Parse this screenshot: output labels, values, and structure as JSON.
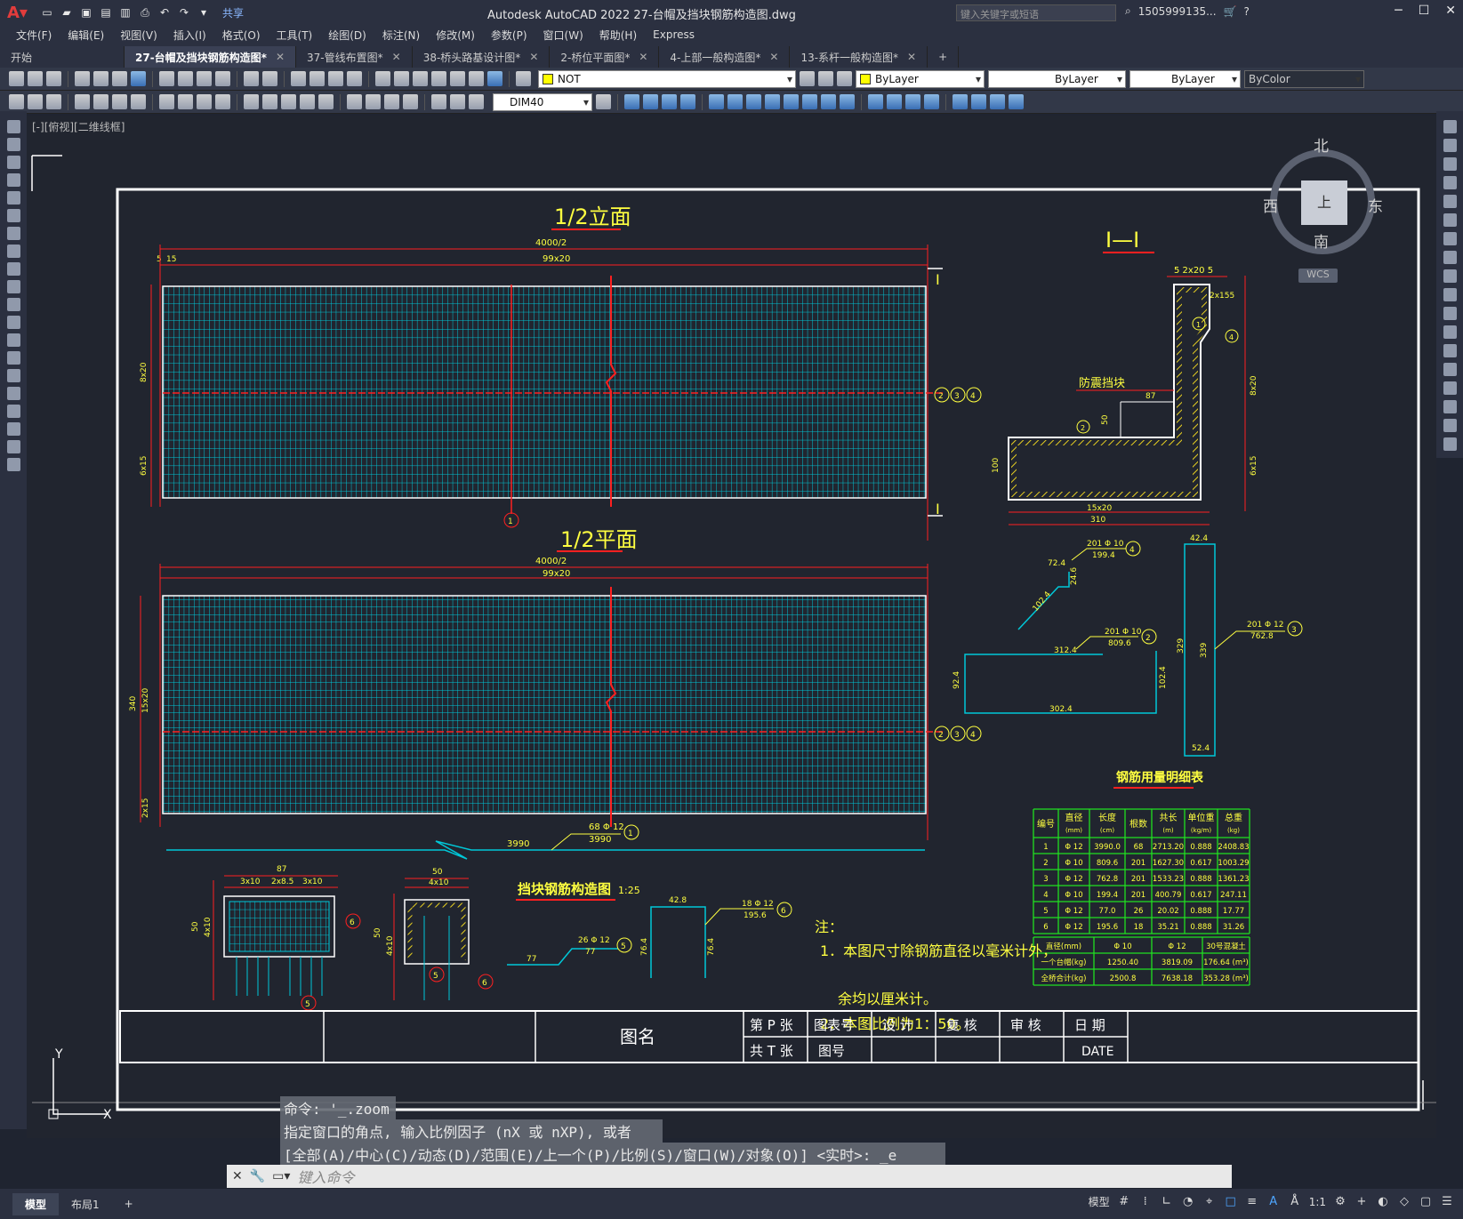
{
  "app": {
    "title": "Autodesk AutoCAD 2022    27-台帽及挡块钢筋构造图.dwg",
    "share_label": "共享",
    "search_placeholder": "键入关键字或短语",
    "user": "1505999135..."
  },
  "menu": [
    "文件(F)",
    "编辑(E)",
    "视图(V)",
    "插入(I)",
    "格式(O)",
    "工具(T)",
    "绘图(D)",
    "标注(N)",
    "修改(M)",
    "参数(P)",
    "窗口(W)",
    "帮助(H)",
    "Express"
  ],
  "tabs": [
    {
      "label": "开始",
      "active": false,
      "closable": false
    },
    {
      "label": "27-台帽及挡块钢筋构造图*",
      "active": true,
      "closable": true
    },
    {
      "label": "37-管线布置图*",
      "active": false,
      "closable": true
    },
    {
      "label": "38-桥头路基设计图*",
      "active": false,
      "closable": true
    },
    {
      "label": "2-桥位平面图*",
      "active": false,
      "closable": true
    },
    {
      "label": "4-上部一般构造图*",
      "active": false,
      "closable": true
    },
    {
      "label": "13-系杆一般构造图*",
      "active": false,
      "closable": true
    }
  ],
  "properties": {
    "layer": "NOT",
    "color": "ByLayer",
    "linetype": "ByLayer",
    "lineweight": "ByLayer",
    "plotstyle": "ByColor",
    "dimstyle": "DIM40"
  },
  "viewport_label": "[-][俯视][二维线框]",
  "viewcube": {
    "north": "北",
    "south": "南",
    "west": "西",
    "east": "东",
    "face": "上",
    "wcs": "WCS"
  },
  "drawing": {
    "elev_title": "1/2立面",
    "plan_title": "1/2平面",
    "section_title": "I—I",
    "block_title": "挡块钢筋构造图",
    "block_scale": "1:25",
    "dim_4000": "4000/2",
    "dim_99x20": "99x20",
    "dim_5": "5",
    "dim_15": "15",
    "dim_340": "340",
    "dim_15x20": "15x20",
    "dim_8x20": "8x20",
    "dim_6x15": "6x15",
    "dim_2x15": "2x15",
    "dim_3990": "3990",
    "label_68": "68 Φ 12",
    "label_3990": "3990",
    "sec_I": "I",
    "antiquake": "防震挡块",
    "dim_87": "87",
    "dim_50": "50",
    "dim_100": "100",
    "dim_310": "310",
    "dim_2x20": "5  2x20  5",
    "dim_2x155": "2x155",
    "dim_4x10": "4x10",
    "dim_3x10": "3x10",
    "dim_2x85": "2x8.5",
    "bar4": {
      "count": "201 Φ 10",
      "len": "199.4",
      "a": "72.4",
      "b": "24.6",
      "c": "102.4"
    },
    "bar2": {
      "count": "201 Φ 10",
      "len": "809.6",
      "a": "312.4",
      "b": "92.4",
      "c": "102.4",
      "d": "302.4"
    },
    "bar3": {
      "count": "201 Φ 12",
      "len": "762.8",
      "a": "42.4",
      "b": "329",
      "c": "339",
      "d": "52.4"
    },
    "bar5": {
      "count": "26 Φ 12",
      "len": "77",
      "a": "77"
    },
    "bar6": {
      "count": "18 Φ 12",
      "len": "195.6",
      "a": "42.8",
      "b": "76.4",
      "c": "76.4"
    },
    "notes_title": "注：",
    "notes": [
      "1．本图尺寸除钢筋直径以毫米计外，",
      "余均以厘米计。",
      "2．本图比例为1：50。"
    ],
    "table_title": "钢筋用量明细表",
    "table_headers": [
      "编号",
      "直径(mm)",
      "长度(cm)",
      "根数",
      "共长(m)",
      "单位重(kg/m)",
      "总重(kg)"
    ],
    "table_rows": [
      [
        "1",
        "Φ 12",
        "3990.0",
        "68",
        "2713.20",
        "0.888",
        "2408.83"
      ],
      [
        "2",
        "Φ 10",
        "809.6",
        "201",
        "1627.30",
        "0.617",
        "1003.29"
      ],
      [
        "3",
        "Φ 12",
        "762.8",
        "201",
        "1533.23",
        "0.888",
        "1361.23"
      ],
      [
        "4",
        "Φ 10",
        "199.4",
        "201",
        "400.79",
        "0.617",
        "247.11"
      ],
      [
        "5",
        "Φ 12",
        "77.0",
        "26",
        "20.02",
        "0.888",
        "17.77"
      ],
      [
        "6",
        "Φ 12",
        "195.6",
        "18",
        "35.21",
        "0.888",
        "31.26"
      ]
    ],
    "summary_headers": [
      "直径(mm)",
      "Φ 10",
      "Φ 12",
      "30号混凝土"
    ],
    "summary_rows": [
      [
        "一个台帽(kg)",
        "1250.40",
        "3819.09",
        "176.64 (m³)"
      ],
      [
        "全桥合计(kg)",
        "2500.8",
        "7638.18",
        "353.28 (m³)"
      ]
    ],
    "titleblock": {
      "name": "图名",
      "sheet_p": "第 P 张",
      "sheet_t": "共 T 张",
      "designer": "图表号",
      "drawno": "图号",
      "design": "设 计",
      "review": "复 核",
      "audit": "审 核",
      "date": "日 期",
      "date_val": "DATE"
    }
  },
  "command": {
    "hist1": "命令: '_.zoom",
    "hist2": "指定窗口的角点, 输入比例因子 (nX 或 nXP), 或者",
    "hist3": "[全部(A)/中心(C)/动态(D)/范围(E)/上一个(P)/比例(S)/窗口(W)/对象(O)] <实时>: _e",
    "placeholder": "键入命令"
  },
  "layout_tabs": [
    "模型",
    "布局1"
  ],
  "status": {
    "model": "模型",
    "scale": "1:1"
  },
  "colors": {
    "bg": "#21252f",
    "grid": "#00c8d8",
    "dim": "#ff2020",
    "text": "#ffff40",
    "frame": "#ffffff"
  }
}
